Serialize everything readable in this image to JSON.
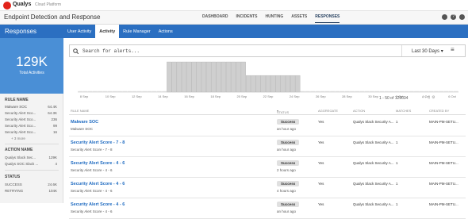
{
  "brand": {
    "name": "Qualys",
    "sub": "Cloud Platform"
  },
  "app": {
    "title": "Endpoint Detection and Response"
  },
  "nav": [
    "DASHBOARD",
    "INCIDENTS",
    "HUNTING",
    "ASSETS",
    "RESPONSES"
  ],
  "section": {
    "title": "Responses",
    "tabs": [
      "User Activity",
      "Activity",
      "Rule Manager",
      "Actions"
    ]
  },
  "summary": {
    "count": "129K",
    "label": "Total Activities"
  },
  "rule_name": {
    "title": "RULE NAME",
    "items": [
      {
        "label": "Malware SOC",
        "value": "64.4K"
      },
      {
        "label": "Security Alert Sco...",
        "value": "64.3K"
      },
      {
        "label": "Security Alert Sco...",
        "value": "236"
      },
      {
        "label": "Security Alert Sco...",
        "value": "99"
      },
      {
        "label": "Security Alert Sco...",
        "value": "16"
      }
    ],
    "more": "3 more"
  },
  "action_name": {
    "title": "ACTION NAME",
    "items": [
      {
        "label": "Qualys Slack Sec...",
        "value": "129K"
      },
      {
        "label": "Qualys SOC Slack ...",
        "value": "4"
      }
    ]
  },
  "status": {
    "title": "STATUS",
    "items": [
      {
        "label": "SUCCESS",
        "value": "24.6K"
      },
      {
        "label": "RETRYING",
        "value": "104K"
      }
    ]
  },
  "search": {
    "placeholder": "Search for alerts...",
    "range": "Last 30 Days"
  },
  "chart_data": {
    "type": "bar",
    "x_ticks": [
      "8 Sep",
      "10 Sep",
      "12 Sep",
      "14 Sep",
      "16 Sep",
      "18 Sep",
      "20 Sep",
      "22 Sep",
      "24 Sep",
      "26 Sep",
      "28 Sep",
      "30 Sep",
      "2 Oct",
      "4 Oct",
      "6 Oct"
    ],
    "values": [
      0,
      0,
      0,
      0,
      0,
      0,
      0,
      0,
      0,
      0,
      0,
      0,
      0,
      0,
      0,
      0,
      0,
      0,
      1,
      1,
      1,
      1,
      1,
      1,
      1,
      1,
      1,
      1,
      1,
      1,
      1,
      1,
      1,
      1,
      0.55,
      0.55,
      0.55,
      0.55,
      0.55,
      0.55,
      0.55,
      0.55,
      0.55,
      0.55,
      0.55,
      0,
      0,
      0,
      0,
      0,
      0,
      0,
      0,
      0,
      0,
      0,
      0,
      0,
      0,
      0,
      0,
      0,
      0,
      0,
      0,
      0,
      0,
      0,
      0,
      0,
      0,
      0,
      0,
      0,
      0,
      0,
      0
    ],
    "color": "#cfcfcf"
  },
  "pagination": "1 - 50 of 129034",
  "table": {
    "headers": [
      "RULE NAME",
      "STATUS",
      "AGGREGATE",
      "ACTION",
      "MATCHES",
      "CREATED BY"
    ],
    "rows": [
      {
        "name": "Malware SOC",
        "desc": "Malware SOC",
        "status": "Success",
        "ago": "an hour ago",
        "agg": "Yes",
        "action": "Qualys Slack Security A...",
        "matches": "1",
        "by": "MAIN-PM-SETU..."
      },
      {
        "name": "Security Alert Score - 7 - 8",
        "desc": "Security Alert Score - 7 - 8",
        "status": "Success",
        "ago": "an hour ago",
        "agg": "Yes",
        "action": "Qualys Slack Security A...",
        "matches": "1",
        "by": "MAIN-PM-SETU..."
      },
      {
        "name": "Security Alert Score - 4 - 6",
        "desc": "Security Alert Score - 4 - 6",
        "status": "Success",
        "ago": "2 hours ago",
        "agg": "Yes",
        "action": "Qualys Slack Security A...",
        "matches": "1",
        "by": "MAIN-PM-SETU..."
      },
      {
        "name": "Security Alert Score - 4 - 6",
        "desc": "Security Alert Score - 4 - 6",
        "status": "Success",
        "ago": "4 hours ago",
        "agg": "Yes",
        "action": "Qualys Slack Security A...",
        "matches": "1",
        "by": "MAIN-PM-SETU..."
      },
      {
        "name": "Security Alert Score - 4 - 6",
        "desc": "Security Alert Score - 4 - 6",
        "status": "Success",
        "ago": "an hour ago",
        "agg": "Yes",
        "action": "Qualys Slack Security A...",
        "matches": "1",
        "by": "MAIN-PM-SETU..."
      }
    ]
  }
}
